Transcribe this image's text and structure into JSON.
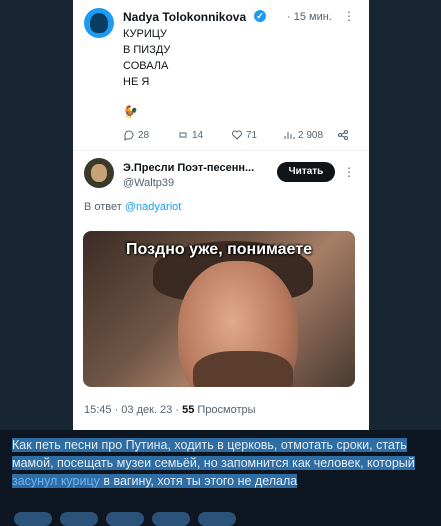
{
  "tweet": {
    "author_name": "Nadya Tolokonnikova",
    "time": "· 15 мин.",
    "text": "КУРИЦУ\nВ ПИЗДУ\nСОВАЛА\nНЕ Я",
    "emoji": "🐓",
    "replies": "28",
    "retweets": "14",
    "likes": "71",
    "views": "2 908"
  },
  "reply_tweet": {
    "author_name": "Э.Пресли Поэт-песенн...",
    "handle": "@Waltp39",
    "follow_label": "Читать",
    "reply_to_prefix": "В ответ",
    "reply_to_handle": "@nadyariot",
    "media_caption": "Поздно уже, понимаете",
    "timestamp": "15:45 · 03 дек. 23 ·",
    "views_count": "55",
    "views_label": "Просмотры"
  },
  "message": {
    "text_before": "Как петь песни про Путина, ходить в церковь, отмотать сроки, стать мамой, посещать музеи семьёй, но запомнится как человек, который ",
    "link_text": "засунул курицу",
    "text_after": " в вагину, хотя ты этого не делала"
  },
  "colors": {
    "chat_bg": "#0e1621",
    "selection": "#2f6ea5",
    "link": "#6ab3f3",
    "twitter_blue": "#1d9bf0"
  }
}
